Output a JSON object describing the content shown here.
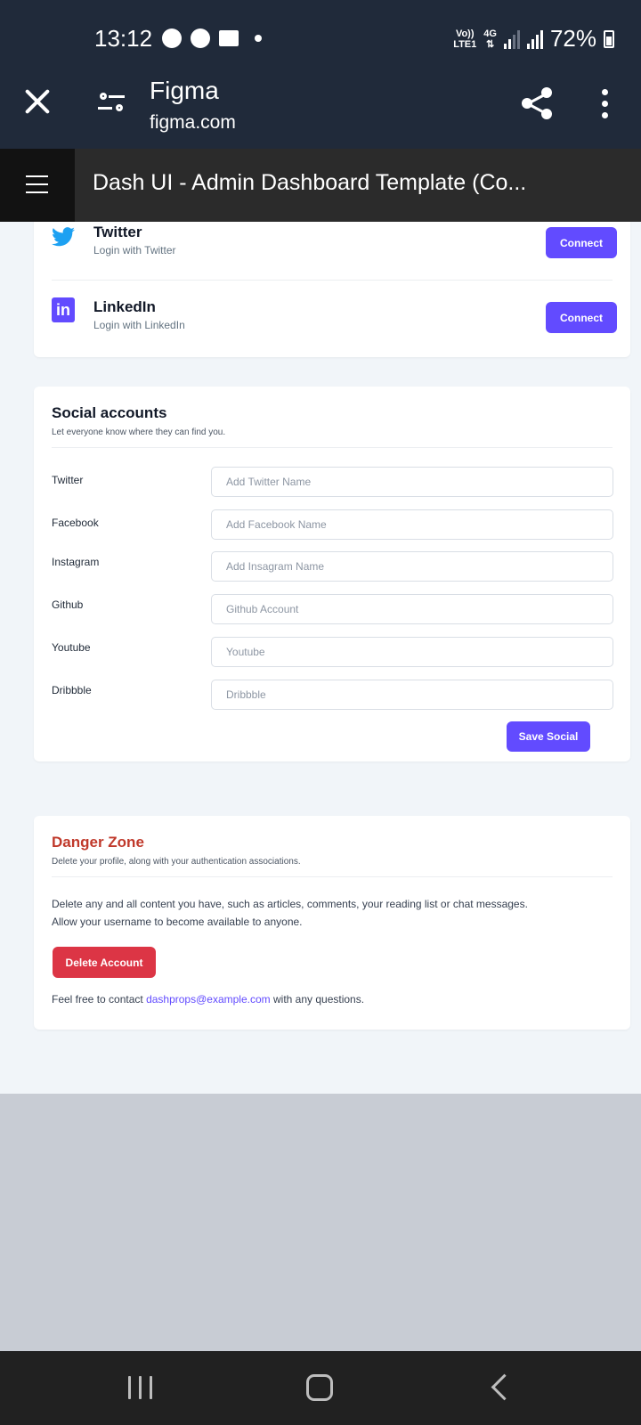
{
  "status_bar": {
    "time": "13:12",
    "network_line1": "Vo))",
    "network_line2": "LTE1",
    "network_type": "4G",
    "battery": "72%"
  },
  "browser": {
    "site_title": "Figma",
    "site_url": "figma.com"
  },
  "tab": {
    "title": "Dash UI - Admin Dashboard Template (Co..."
  },
  "connected_services": [
    {
      "name": "Twitter",
      "subtitle": "Login with Twitter",
      "button": "Connect",
      "icon": "twitter-icon",
      "color": "#1da1f2"
    },
    {
      "name": "LinkedIn",
      "subtitle": "Login with LinkedIn",
      "button": "Connect",
      "icon": "linkedin-icon",
      "color": "#624bff"
    }
  ],
  "social_accounts": {
    "title": "Social accounts",
    "subtitle": "Let everyone know where they can find you.",
    "fields": [
      {
        "label": "Twitter",
        "placeholder": "Add Twitter Name",
        "value": ""
      },
      {
        "label": "Facebook",
        "placeholder": "Add Facebook Name",
        "value": ""
      },
      {
        "label": "Instagram",
        "placeholder": "Add Insagram Name",
        "value": ""
      },
      {
        "label": "Github",
        "placeholder": "Github Account",
        "value": ""
      },
      {
        "label": "Youtube",
        "placeholder": "Youtube",
        "value": ""
      },
      {
        "label": "Dribbble",
        "placeholder": "Dribbble",
        "value": ""
      }
    ],
    "save_button": "Save Social"
  },
  "danger_zone": {
    "title": "Danger Zone",
    "subtitle": "Delete your profile, along with your authentication associations.",
    "body_line1": "Delete any and all content you have, such as articles, comments, your reading list or chat messages.",
    "body_line2": "Allow your username to become available to anyone.",
    "delete_button": "Delete Account",
    "contact_prefix": "Feel free to contact ",
    "contact_email": "dashprops@example.com",
    "contact_suffix": " with any questions."
  },
  "colors": {
    "primary": "#624bff",
    "danger": "#dc3545",
    "danger_title": "#c0392b",
    "chrome": "#202a3a"
  }
}
